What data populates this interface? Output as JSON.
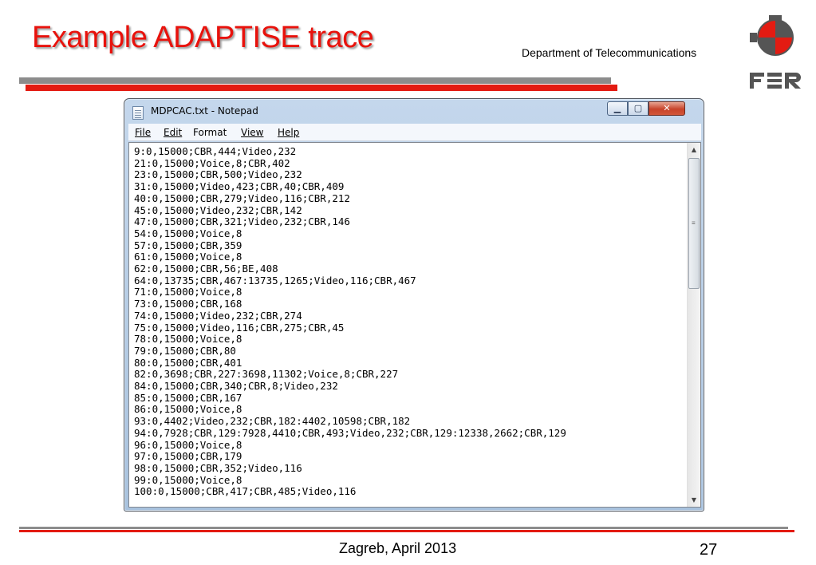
{
  "slide": {
    "title": "Example ADAPTISE trace",
    "department": "Department of Telecommunications",
    "footer": "Zagreb, April 2013",
    "page_number": "27",
    "colors": {
      "accent": "#e31b12",
      "title": "#e8120c",
      "bar_gray": "#8c8c8c"
    },
    "logo_icon": "fer-logo-icon"
  },
  "window": {
    "title": "MDPCAC.txt - Notepad",
    "buttons": {
      "minimize": "minimize-icon",
      "maximize": "maximize-icon",
      "close": "close-icon"
    },
    "menu": [
      "File",
      "Edit",
      "Format",
      "View",
      "Help"
    ]
  },
  "editor": {
    "lines": [
      "9:0,15000;CBR,444;Video,232",
      "21:0,15000;Voice,8;CBR,402",
      "23:0,15000;CBR,500;Video,232",
      "31:0,15000;Video,423;CBR,40;CBR,409",
      "40:0,15000;CBR,279;Video,116;CBR,212",
      "45:0,15000;Video,232;CBR,142",
      "47:0,15000;CBR,321;Video,232;CBR,146",
      "54:0,15000;Voice,8",
      "57:0,15000;CBR,359",
      "61:0,15000;Voice,8",
      "62:0,15000;CBR,56;BE,408",
      "64:0,13735;CBR,467:13735,1265;Video,116;CBR,467",
      "71:0,15000;Voice,8",
      "73:0,15000;CBR,168",
      "74:0,15000;Video,232;CBR,274",
      "75:0,15000;Video,116;CBR,275;CBR,45",
      "78:0,15000;Voice,8",
      "79:0,15000;CBR,80",
      "80:0,15000;CBR,401",
      "82:0,3698;CBR,227:3698,11302;Voice,8;CBR,227",
      "84:0,15000;CBR,340;CBR,8;Video,232",
      "85:0,15000;CBR,167",
      "86:0,15000;Voice,8",
      "93:0,4402;Video,232;CBR,182:4402,10598;CBR,182",
      "94:0,7928;CBR,129:7928,4410;CBR,493;Video,232;CBR,129:12338,2662;CBR,129",
      "96:0,15000;Voice,8",
      "97:0,15000;CBR,179",
      "98:0,15000;CBR,352;Video,116",
      "99:0,15000;Voice,8",
      "100:0,15000;CBR,417;CBR,485;Video,116"
    ]
  }
}
